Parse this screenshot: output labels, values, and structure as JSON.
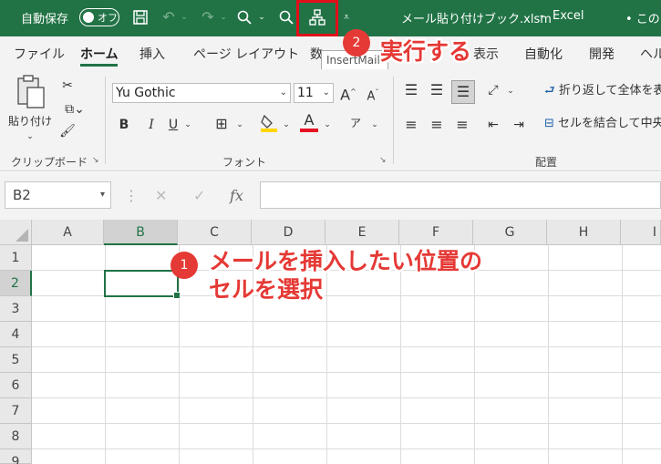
{
  "titlebar": {
    "autosave_label": "自動保存",
    "autosave_state": "オフ",
    "filename": "メール貼り付けブック.xlsm",
    "separator": "-",
    "app_name": "Excel",
    "user_partial": "• この",
    "icons": {
      "save": "save-icon",
      "undo": "undo-icon",
      "redo": "redo-icon",
      "search": "search-icon",
      "macro": "insert-mail-macro-icon",
      "customize": "qat-customize-icon"
    }
  },
  "tabs": [
    {
      "label": "ファイル"
    },
    {
      "label": "ホーム"
    },
    {
      "label": "挿入"
    },
    {
      "label": "ページ レイアウト"
    },
    {
      "label": "数"
    },
    {
      "label": "表示"
    },
    {
      "label": "自動化"
    },
    {
      "label": "開発"
    },
    {
      "label": "ヘル"
    }
  ],
  "tooltip": "InsertMail",
  "ribbon": {
    "clipboard": {
      "paste_label": "貼り付け",
      "group_label": "クリップボード"
    },
    "font": {
      "font_name": "Yu Gothic",
      "font_size": "11",
      "bold": "B",
      "italic": "I",
      "underline": "U",
      "grow": "A",
      "shrink": "A",
      "font_color_glyph": "A",
      "phonetic_glyph": "ア",
      "group_label": "フォント"
    },
    "alignment": {
      "wrap_text": "折り返して全体を表",
      "merge_center": "セルを結合して中央",
      "group_label": "配置"
    },
    "colors": {
      "highlight": "#ffd700",
      "font_color": "#e81123"
    }
  },
  "formula_bar": {
    "name_box": "B2",
    "cancel": "✕",
    "enter": "✓",
    "fx": "fx",
    "formula": ""
  },
  "grid": {
    "columns": [
      "A",
      "B",
      "C",
      "D",
      "E",
      "F",
      "G",
      "H",
      "I"
    ],
    "rows": [
      "1",
      "2",
      "3",
      "4",
      "5",
      "6",
      "7",
      "8",
      "9"
    ],
    "selected_column": "B",
    "selected_row": "2",
    "active_cell": "B2"
  },
  "annotations": {
    "step1_number": "1",
    "step1_line1": "メールを挿入したい位置の",
    "step1_line2": "セルを選択",
    "step2_number": "2",
    "step2_text": "実行する",
    "color": "#e53935"
  },
  "theme": {
    "excel_green": "#217346",
    "highlight_red": "#e0101a"
  }
}
